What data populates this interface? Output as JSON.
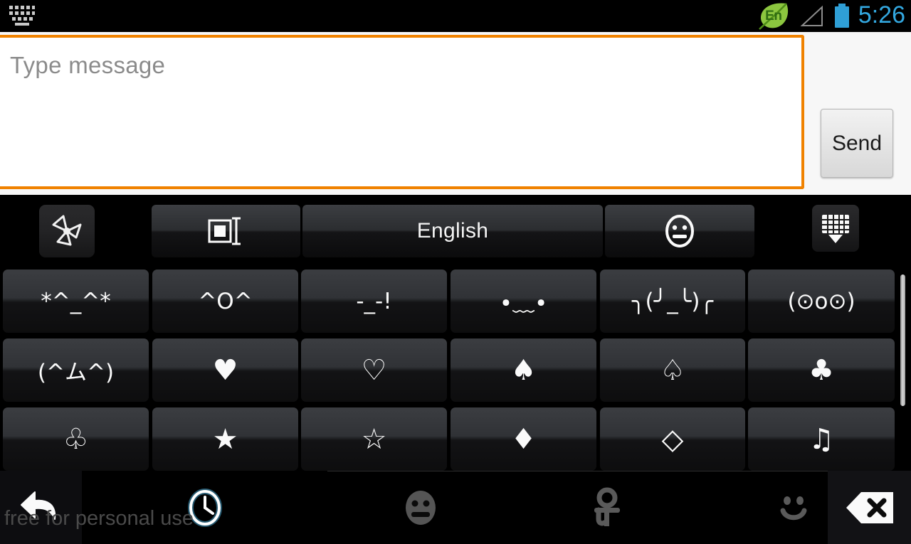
{
  "status_bar": {
    "left_icon": "keyboard-icon",
    "language_badge": "En",
    "signal_icon": "signal-triangle-icon",
    "battery_icon": "battery-icon",
    "time": "5:26",
    "time_color": "#33a8e0",
    "leaf_color": "#8bc63e"
  },
  "compose": {
    "placeholder": "Type message",
    "value": "",
    "send_label": "Send",
    "focus_border_color": "#f08200"
  },
  "keyboard": {
    "toolbar": {
      "logo_icon": "app-logo-icon",
      "layout_icon": "text-field-layout-icon",
      "language_label": "English",
      "emoji_icon": "smiley-face-icon",
      "hide_keyboard_icon": "hide-keyboard-icon"
    },
    "emoticon_rows": [
      [
        "*^_^*",
        "^O^",
        "-_-!",
        "•﹏•",
        "╮(╯_╰)╭",
        "(⊙o⊙)"
      ],
      [
        "(^ム^)",
        "♥",
        "♡",
        "♠",
        "♤",
        "♣"
      ],
      [
        "♧",
        "★",
        "☆",
        "♦",
        "◇",
        "♫"
      ]
    ],
    "scrollbar": "vertical-scrollbar",
    "bottom_bar": [
      {
        "name": "back-arrow-icon",
        "selected": false
      },
      {
        "name": "recent-clock-icon",
        "selected": true
      },
      {
        "name": "emoticon-face-icon",
        "selected": false
      },
      {
        "name": "symbol-icon",
        "selected": false
      },
      {
        "name": "smiley-icon",
        "selected": false
      },
      {
        "name": "backspace-icon",
        "selected": false
      }
    ]
  },
  "watermark": "free for personal use"
}
